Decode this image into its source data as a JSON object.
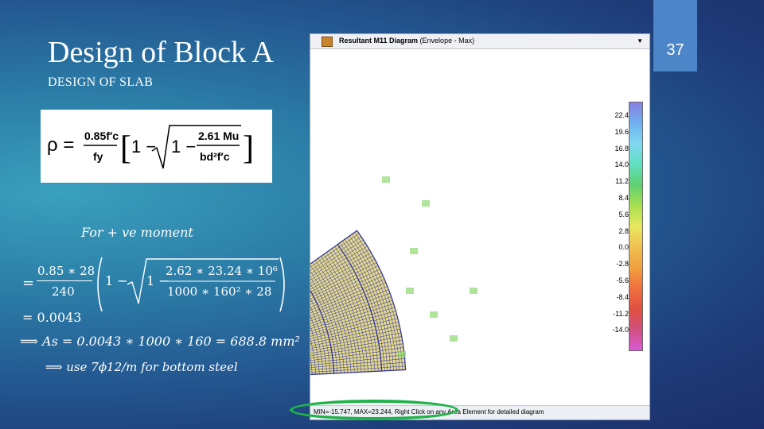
{
  "slide": {
    "title": "Design of Block A",
    "subtitle": "DESIGN OF SLAB",
    "page_number": "37"
  },
  "formula": {
    "rho": "ρ =",
    "num": "0.85f′c",
    "den": "fy",
    "inner_num": "2.61 Mu",
    "inner_den": "bd²f′c",
    "one": "1 −"
  },
  "calc": {
    "heading": "For + ve moment",
    "eq_prefix": "=",
    "frac1_num": "0.85 ∗ 28",
    "frac1_den": "240",
    "one_minus": "1 −",
    "inner_one_minus": "1 −",
    "frac2_num": "2.62 ∗ 23.24 ∗ 10⁶",
    "frac2_den": "1000 ∗ 160² ∗ 28",
    "result": "= 0.0043",
    "as_line": "⟹ As = 0.0043 ∗ 1000 ∗ 160 = 688.8 mm²",
    "use_line": "⟹ use 7ϕ12/m  for  bottom steel"
  },
  "sap_window": {
    "title_bold": "Resultant M11 Diagram",
    "title_rest": "(Envelope - Max)",
    "status": "MIN=-15.747, MAX=23.244, Right Click on any Area Element for detailed diagram",
    "legend": [
      "22.4",
      "19.6",
      "16.8",
      "14.0",
      "11.2",
      "8.4",
      "5.6",
      "2.8",
      "0.0",
      "-2.8",
      "-5.6",
      "-8.4",
      "-11.2",
      "-14.0"
    ],
    "colors": {
      "legend_top": "#8a7fe0",
      "legend_bottom": "#d95ad6",
      "mesh_line": "#2b2fa0",
      "mesh_fill": "#e4d98c",
      "highlight": "#1fb34a"
    }
  }
}
